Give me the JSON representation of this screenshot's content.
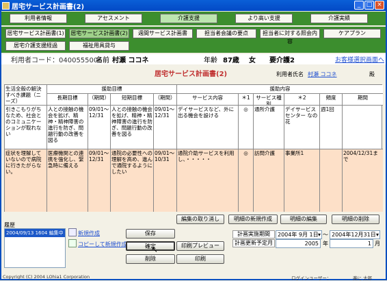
{
  "window": {
    "title": "居宅サービス計画書(2)"
  },
  "nav": {
    "main_tabs": [
      "利用者情報",
      "アセスメント",
      "介護支援",
      "より高い支援",
      "介護実績"
    ],
    "sub_tabs_row1": [
      "居宅サービス計画書(1)",
      "居宅サービス計画書(2)",
      "週間サービス計画書",
      "担当者会議の要点",
      "担当者に対する照会内容",
      "ケアプラン"
    ],
    "sub_tabs_row2": [
      "居宅介護支援経過",
      "福祉用具貸与"
    ]
  },
  "user_info": {
    "code_label": "利用者コード：0400555006",
    "name_label": "名前",
    "name_value": "村瀬 ココネ",
    "age_label": "年齢",
    "age_value": "87歳",
    "sex": "女",
    "care_level": "要介護2",
    "select_link": "お客様選択画面へ"
  },
  "sheet": {
    "title": "居宅サービス計画書(2)",
    "user_label": "利用者氏名",
    "user_name": "村瀬 ココネ",
    "honorific": "殿"
  },
  "table": {
    "h_needs": "生活全般の解決すべき課題（ニーズ）",
    "h_goals": "援助目標",
    "h_long": "長期目標",
    "h_period": "（期間）",
    "h_short": "短期目標",
    "h_period2": "（期間）",
    "h_content": "援助内容",
    "h_service": "サービス内容",
    "h_mark1": "＊1",
    "h_type": "サービス種別",
    "h_mark2": "＊2",
    "h_freq": "頻度",
    "h_term": "期間",
    "rows": [
      {
        "needs": "引きこもりがちなため、社会とのコミュニケーションが取れない",
        "long": "人との接触の機会を拡げ、精神・精神障害の進行を防ぎ、問題行動の改善を図る",
        "long_period": "09/01～12/31",
        "short": "人との接触の機会を拡げ、精神・精神障害の進行を防ぎ、問題行動の改善を図る",
        "short_period": "09/01～12/31",
        "service": "デイサービスなど、外に出る機会を設ける",
        "mark1": "◎",
        "type": "通所介護",
        "provider": "デイサービスセンター なの花",
        "freq": "週1回",
        "term": ""
      },
      {
        "needs": "症状を理解していないので病院に行きたがらない。",
        "long": "医療機関との連携を強化し、緊急時に備える",
        "long_period": "09/01～12/31",
        "short": "通院の必要性への理解を高め、進んで通院するようにしたい",
        "short_period": "09/01～10/31",
        "service": "通院介助サービスを利用し、・・・・・",
        "mark1": "◎",
        "type": "訪問介護",
        "provider": "事業所1",
        "freq": "",
        "term": "2004/12/31まで"
      }
    ]
  },
  "actions": {
    "cancel_edit": "編集の取り消し",
    "new_detail": "明細の新規作成",
    "edit_detail": "明細の編集",
    "delete_detail": "明細の削除",
    "save": "保存",
    "confirm": "確定",
    "delete": "削除",
    "print_preview": "印刷プレビュー",
    "print": "印刷"
  },
  "history": {
    "label": "履歴",
    "items": [
      "2004/09/13 1604 編集中"
    ],
    "new_link": "新規作成",
    "copy_link": "コピーして新規作成"
  },
  "plan": {
    "period_label": "計画実施期間",
    "period_from": "2004年 9月 1日",
    "tilde": "～",
    "period_to": "2004年12月31日",
    "update_label": "計画更新予定月",
    "update_year": "2005",
    "year_unit": "年",
    "update_month": "1",
    "month_unit": "月"
  },
  "status": {
    "copyright": "Copyright (C) 2004 LOhia1 Corporation",
    "login_label": "ログインユーザー：",
    "login_user": "楽に 太郎"
  }
}
